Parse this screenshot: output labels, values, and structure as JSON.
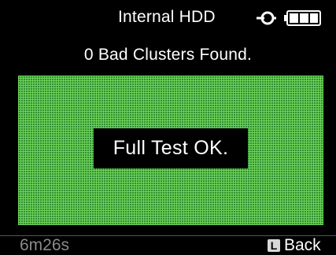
{
  "header": {
    "title": "Internal HDD",
    "power_icon": "power-plug-icon",
    "battery_icon": "battery-full-icon"
  },
  "summary": {
    "text": "0 Bad Clusters Found."
  },
  "cluster_map": {
    "color": "#2e8f31",
    "grid_color": "#6fd25a",
    "bad_clusters": 0
  },
  "result": {
    "text": "Full Test OK."
  },
  "footer": {
    "elapsed": "6m26s",
    "back_key": "L",
    "back_label": "Back"
  }
}
